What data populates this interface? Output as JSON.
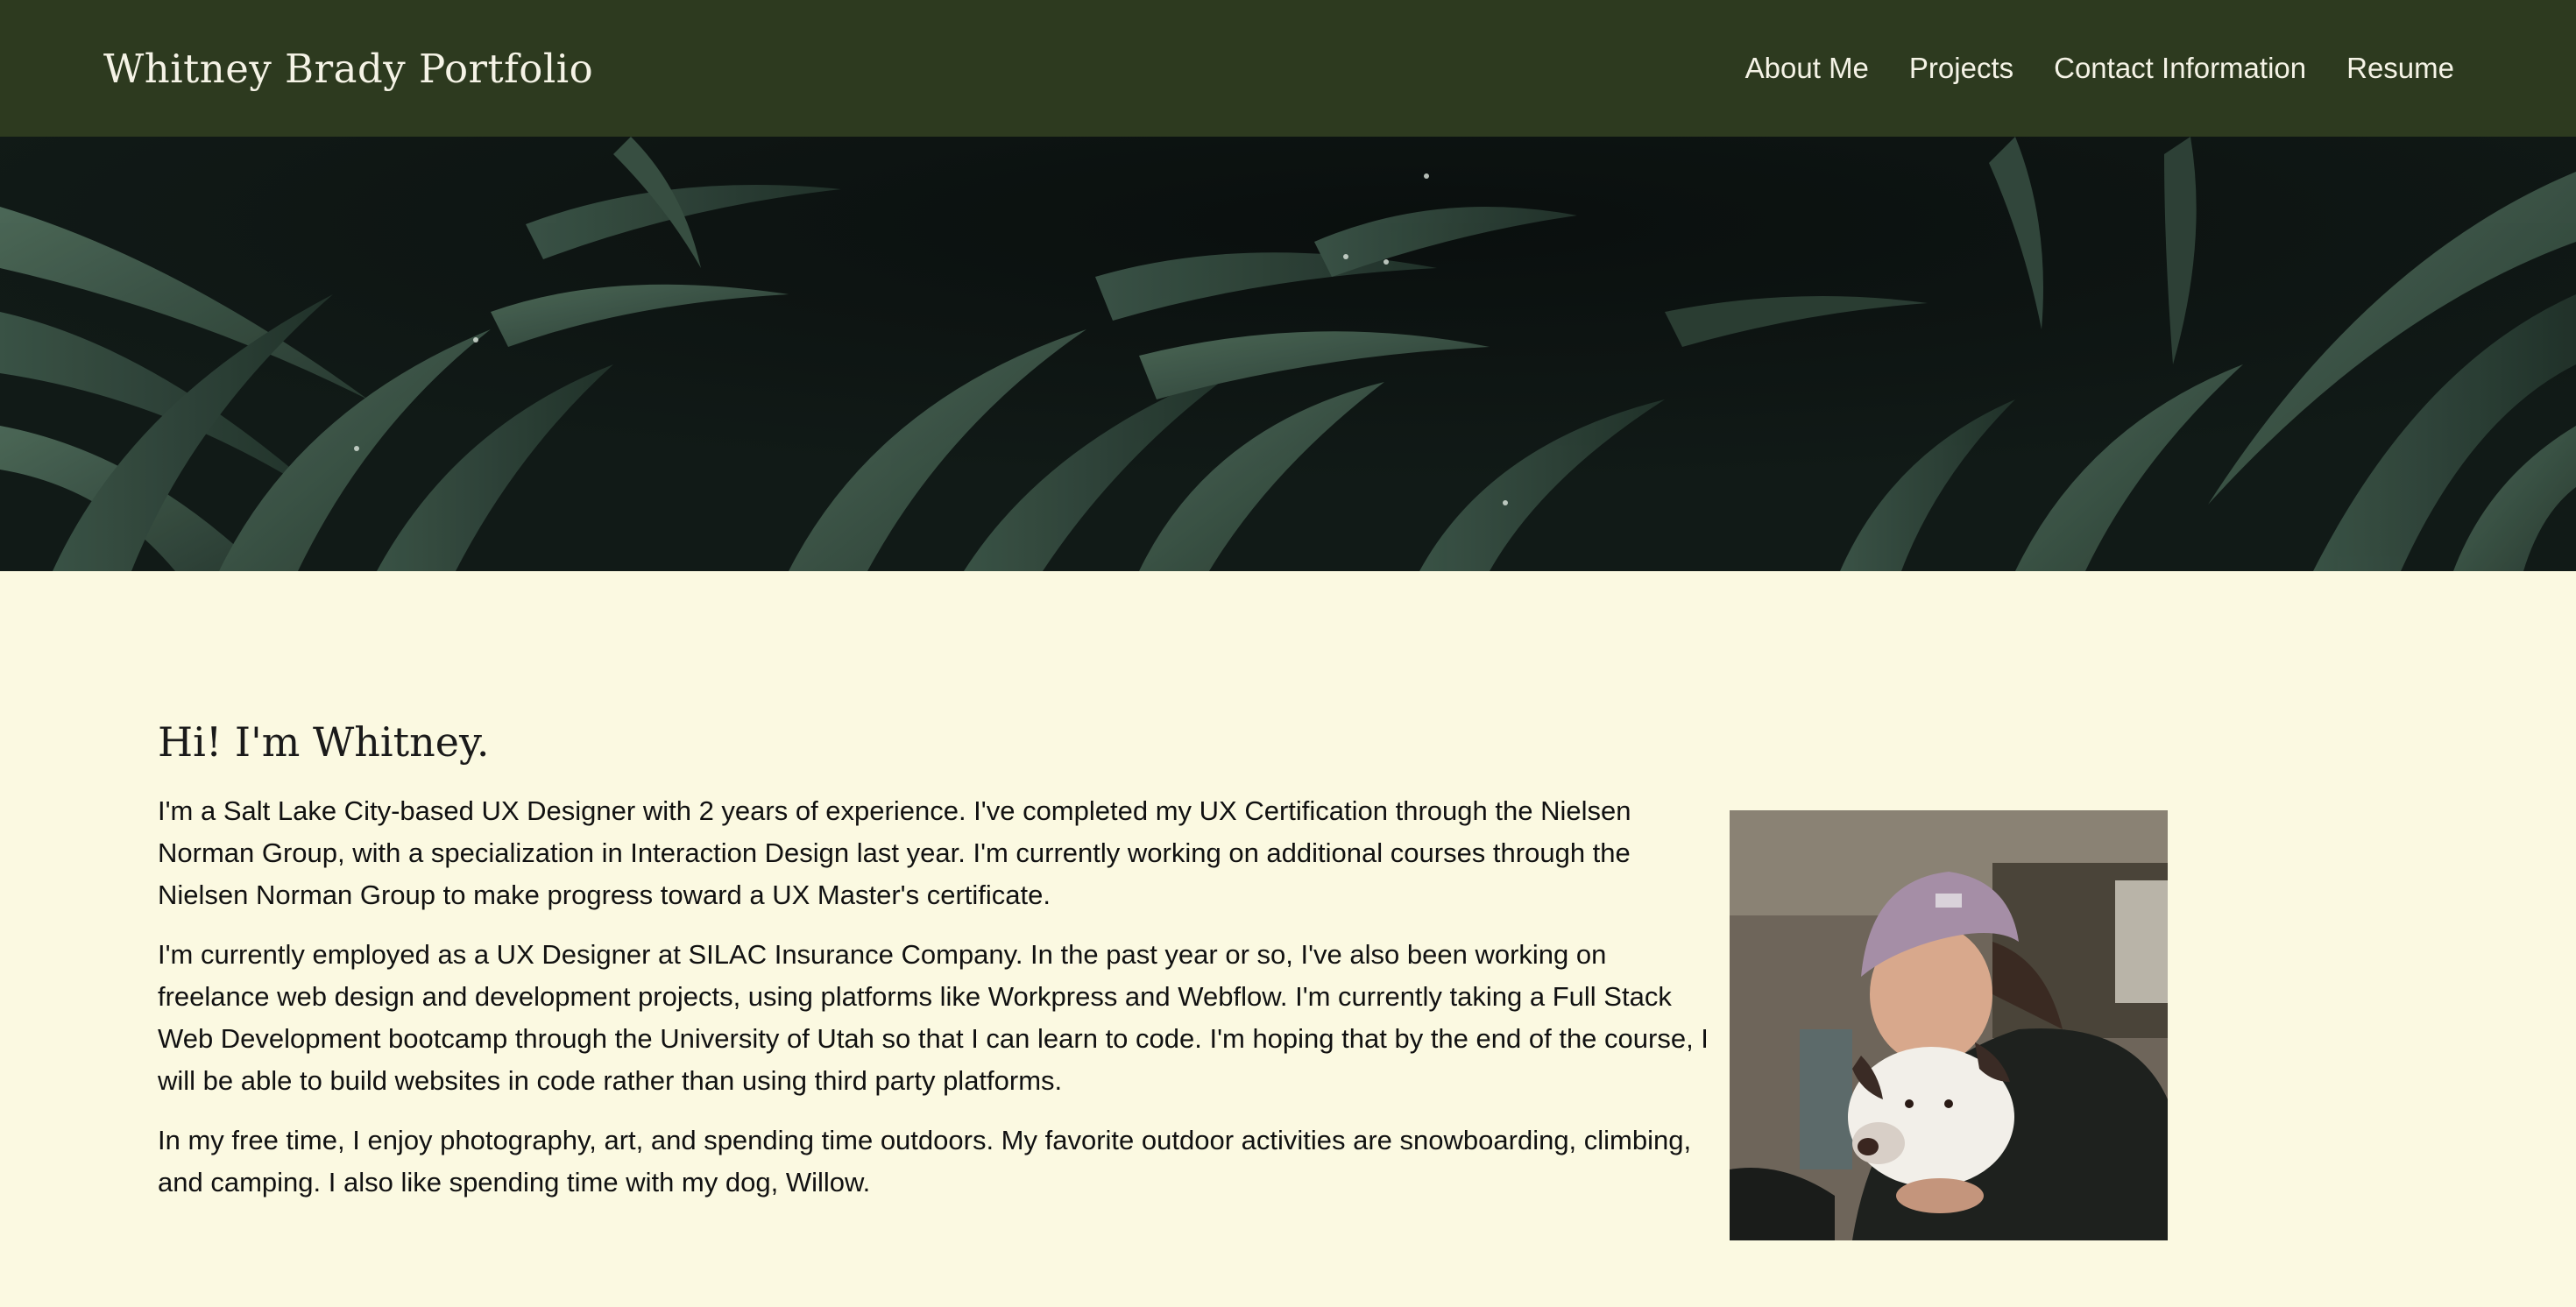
{
  "navbar": {
    "brand": "Whitney Brady Portfolio",
    "links": [
      {
        "label": "About Me"
      },
      {
        "label": "Projects"
      },
      {
        "label": "Contact Information"
      },
      {
        "label": "Resume"
      }
    ],
    "background_color": "#2d3a1f"
  },
  "hero": {
    "image": "palm-leaves-banner"
  },
  "about": {
    "heading": "Hi! I'm Whitney.",
    "paragraphs": [
      "I'm a Salt Lake City-based UX Designer with 2 years of experience. I've completed my UX Certification through the Nielsen Norman Group, with a specialization in Interaction Design last year. I'm currently working on additional courses through the Nielsen Norman Group to make progress toward a UX Master's certificate.",
      "I'm currently employed as a UX Designer at SILAC Insurance Company. In the past year or so, I've also been working on freelance web design and development projects, using platforms like Workpress and Webflow. I'm currently taking a Full Stack Web Development bootcamp through the University of Utah so that I can learn to code. I'm hoping that by the end of the course, I will be able to build websites in code rather than using third party platforms.",
      "In my free time, I enjoy photography, art, and spending time outdoors. My favorite outdoor activities are snowboarding, climbing, and camping. I also like spending time with my dog, Willow."
    ],
    "photo": "whitney-with-dog-photo",
    "background_color": "#fbf9e1"
  }
}
